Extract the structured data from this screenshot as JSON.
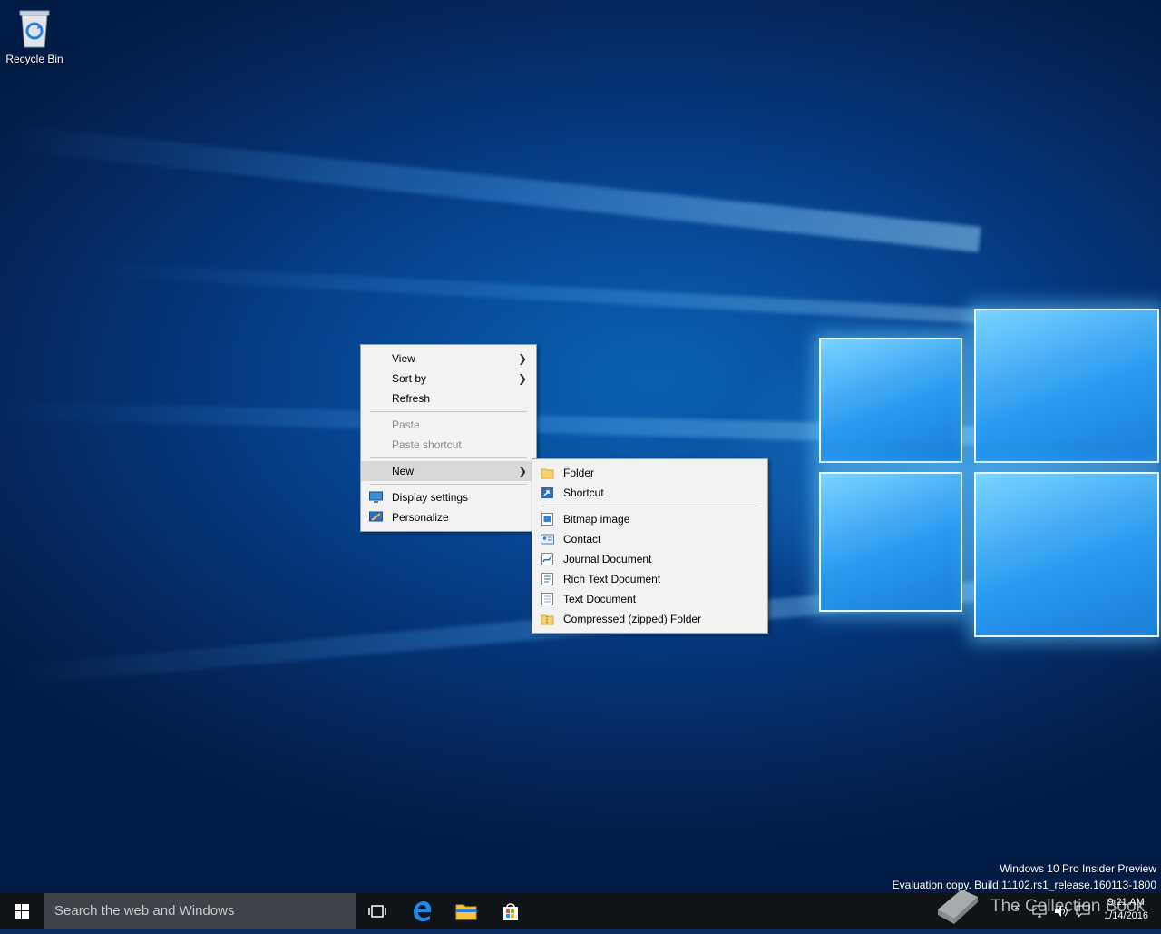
{
  "desktop": {
    "recycle_bin_label": "Recycle Bin",
    "watermark_line1": "Windows 10 Pro Insider Preview",
    "watermark_line2": "Evaluation copy. Build 11102.rs1_release.160113-1800"
  },
  "context_menu": {
    "view": "View",
    "sort_by": "Sort by",
    "refresh": "Refresh",
    "paste": "Paste",
    "paste_shortcut": "Paste shortcut",
    "new": "New",
    "display_settings": "Display settings",
    "personalize": "Personalize"
  },
  "new_submenu": {
    "folder": "Folder",
    "shortcut": "Shortcut",
    "bitmap_image": "Bitmap image",
    "contact": "Contact",
    "journal_document": "Journal Document",
    "rich_text_document": "Rich Text Document",
    "text_document": "Text Document",
    "compressed_folder": "Compressed (zipped) Folder"
  },
  "taskbar": {
    "search_placeholder": "Search the web and Windows",
    "time": "9:21 AM",
    "date": "1/14/2016"
  },
  "overlay": {
    "brand_text": "The Collection Book"
  },
  "colors": {
    "menu_bg": "#f2f2f2",
    "menu_active": "#d9d9d9",
    "taskbar_bg": "#101419",
    "search_bg": "#3f4349"
  }
}
